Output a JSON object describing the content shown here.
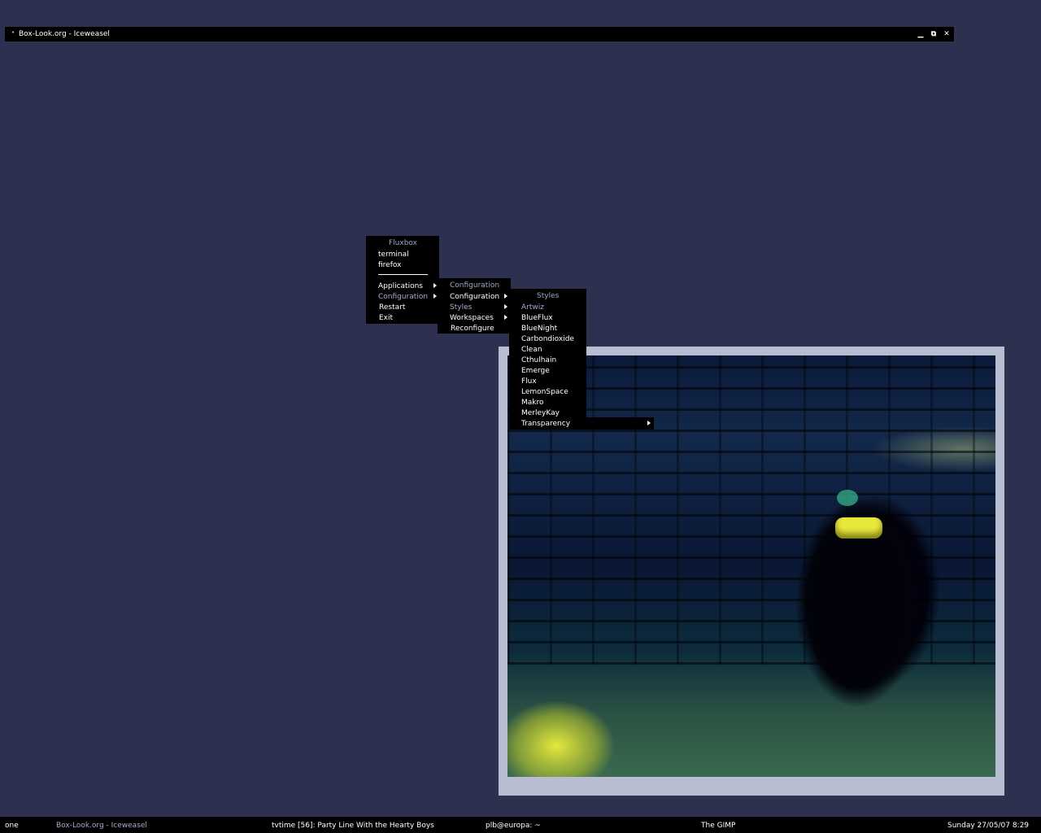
{
  "window": {
    "title": "Box-Look.org - Iceweasel",
    "icon": "menu-dot-icon",
    "buttons": {
      "minimize": "▁",
      "maximize": "⧉",
      "close": "✕"
    }
  },
  "root_menu": {
    "title": "Fluxbox",
    "items": [
      "terminal",
      "firefox"
    ],
    "submenus": [
      "Applications",
      "Configuration",
      "Restart",
      "Exit"
    ]
  },
  "config_menu": {
    "title": "Configuration",
    "items": [
      "Configuration",
      "Styles",
      "Workspaces",
      "Reconfigure"
    ]
  },
  "styles_menu": {
    "title": "Styles",
    "items": [
      "Artwiz",
      "BlueFlux",
      "BlueNight",
      "Carbondioxide",
      "Clean",
      "Cthulhain",
      "Emerge",
      "Flux",
      "LemonSpace",
      "Makro",
      "MerleyKay",
      "Transparency"
    ]
  },
  "taskbar": {
    "workspace": "one",
    "tasks": [
      "Box-Look.org - Iceweasel",
      "tvtime [56]: Party Line With the Hearty Boys",
      "plb@europa: ~",
      "The GIMP"
    ],
    "clock": "Sunday 27/05/07  8:29"
  },
  "colors": {
    "desktop": "#2e3050",
    "menu_bg": "#000000",
    "menu_title": "#9fa6c4",
    "frame": "#b9bdd2"
  }
}
